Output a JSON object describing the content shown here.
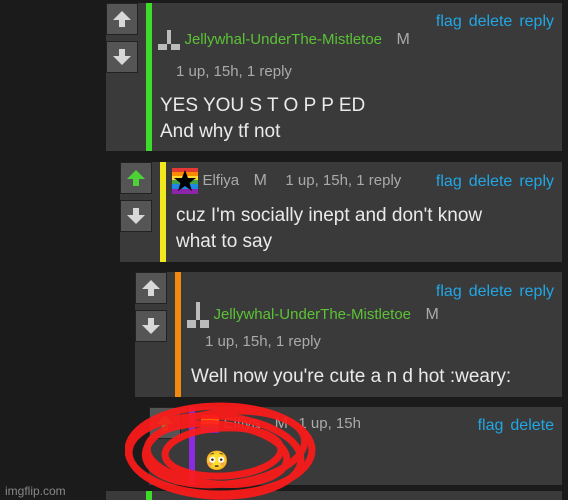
{
  "actions": {
    "flag": "flag",
    "delete": "delete",
    "reply": "reply"
  },
  "comments": [
    {
      "author": "Jellywhal-UnderThe-Mistletoe",
      "badge": "M",
      "meta": "1 up, 15h, 1 reply",
      "text": "YES YOU S T O P P ED\nAnd why tf not",
      "bar_color": "#3ddc2a"
    },
    {
      "author": "Elfiya",
      "badge": "M",
      "meta": "1 up, 15h, 1 reply",
      "text": "cuz I'm socially inept and don't know\nwhat to say",
      "bar_color": "#f2e81e",
      "upvoted": true
    },
    {
      "author": "Jellywhal-UnderThe-Mistletoe",
      "badge": "M",
      "meta": "1 up, 15h, 1 reply",
      "text": "Well now you're cute a n d hot :weary:",
      "bar_color": "#f28a10"
    },
    {
      "author": "Elfiya",
      "badge": "M",
      "meta": "1 up, 15h",
      "text": "😳",
      "bar_color": "#8a2be2"
    }
  ],
  "colors": {
    "link": "#21a7e6",
    "green_author": "#5bc236",
    "scribble": "#ff1a1a"
  },
  "watermark": "imgflip.com"
}
